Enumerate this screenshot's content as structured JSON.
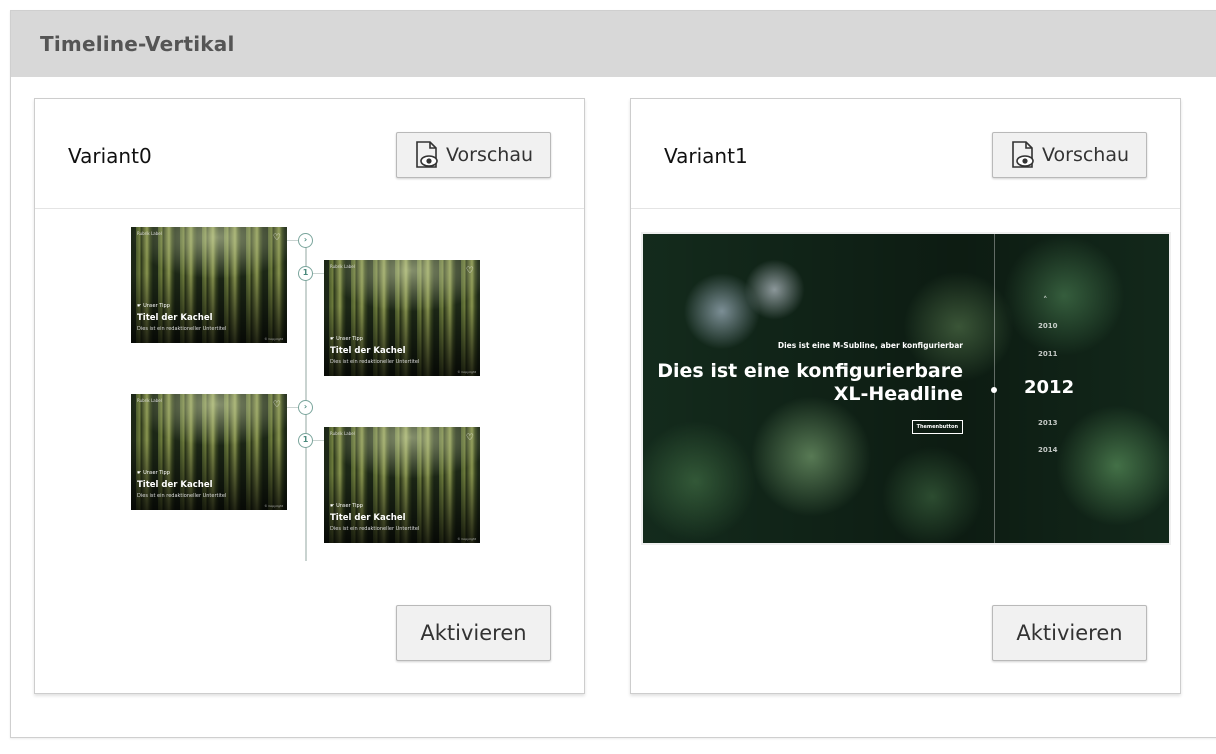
{
  "panel": {
    "title": "Timeline-Vertikal"
  },
  "variants": [
    {
      "title": "Variant0",
      "preview_label": "Vorschau",
      "activate_label": "Aktivieren",
      "tiles": [
        {
          "tag": "Rubrik Label",
          "badge": "☛ Unser Tipp",
          "title": "Titel der Kachel",
          "subtitle": "Dies ist ein redaktioneller Untertitel",
          "copyright": "© Copyright"
        },
        {
          "tag": "Rubrik Label",
          "badge": "☛ Unser Tipp",
          "title": "Titel der Kachel",
          "subtitle": "Dies ist ein redaktioneller Untertitel",
          "copyright": "© Copyright"
        },
        {
          "tag": "Rubrik Label",
          "badge": "☛ Unser Tipp",
          "title": "Titel der Kachel",
          "subtitle": "Dies ist ein redaktioneller Untertitel",
          "copyright": "© Copyright"
        },
        {
          "tag": "Rubrik Label",
          "badge": "☛ Unser Tipp",
          "title": "Titel der Kachel",
          "subtitle": "Dies ist ein redaktioneller Untertitel",
          "copyright": "© Copyright"
        }
      ],
      "timeline_nodes": [
        "›",
        "1",
        "›",
        "1"
      ]
    },
    {
      "title": "Variant1",
      "preview_label": "Vorschau",
      "activate_label": "Aktivieren",
      "hero": {
        "subline": "Dies ist eine M-Subline, aber konfigurierbar",
        "headline_line1": "Dies ist eine konfigurierbare",
        "headline_line2": "XL-Headline",
        "button": "Themenbutton",
        "year_up": "˄",
        "years": [
          "2010",
          "2011",
          "2012",
          "2013",
          "2014"
        ]
      }
    }
  ],
  "icons": {
    "preview": "document-eye-icon"
  },
  "colors": {
    "header_bg": "#d8d8d8",
    "button_bg": "#f1f1f1",
    "timeline_accent": "#4b8a7d"
  }
}
